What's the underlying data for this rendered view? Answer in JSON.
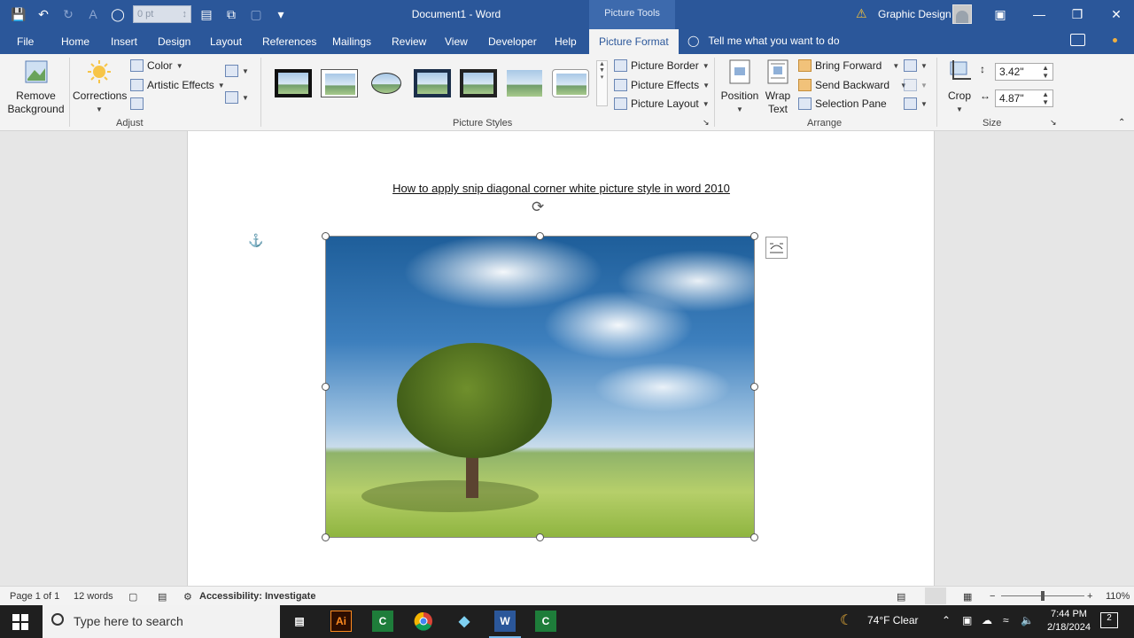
{
  "titlebar": {
    "font_box_value": "0 pt",
    "doc_title": "Document1 - Word",
    "context_tab_group": "Picture Tools",
    "user_name": "Graphic Design"
  },
  "tabs": [
    "File",
    "Home",
    "Insert",
    "Design",
    "Layout",
    "References",
    "Mailings",
    "Review",
    "View",
    "Developer",
    "Help"
  ],
  "active_tab": "Picture Format",
  "tellme": "Tell me what you want to do",
  "ribbon": {
    "adjust": {
      "remove_bg_line1": "Remove",
      "remove_bg_line2": "Background",
      "corrections": "Corrections",
      "color": "Color",
      "artistic_effects": "Artistic Effects",
      "label": "Adjust"
    },
    "picture_styles": {
      "label": "Picture Styles",
      "border": "Picture Border",
      "effects": "Picture Effects",
      "layout": "Picture Layout"
    },
    "arrange": {
      "position": "Position",
      "wrap_line1": "Wrap",
      "wrap_line2": "Text",
      "bring_forward": "Bring Forward",
      "send_backward": "Send Backward",
      "selection_pane": "Selection Pane",
      "label": "Arrange"
    },
    "size": {
      "crop": "Crop",
      "height": "3.42\"",
      "width": "4.87\"",
      "label": "Size"
    }
  },
  "document": {
    "heading": "How to apply snip diagonal corner white picture style in word 2010"
  },
  "statusbar": {
    "page": "Page 1 of 1",
    "words": "12 words",
    "accessibility": "Accessibility: Investigate",
    "zoom": "110%"
  },
  "taskbar": {
    "search_placeholder": "Type here to search",
    "weather": "74°F  Clear",
    "time": "7:44 PM",
    "date": "2/18/2024",
    "notifications": "2"
  },
  "colors": {
    "word_blue": "#2b579a",
    "ribbon_bg": "#f3f3f3",
    "taskbar": "#1f1f1f"
  }
}
